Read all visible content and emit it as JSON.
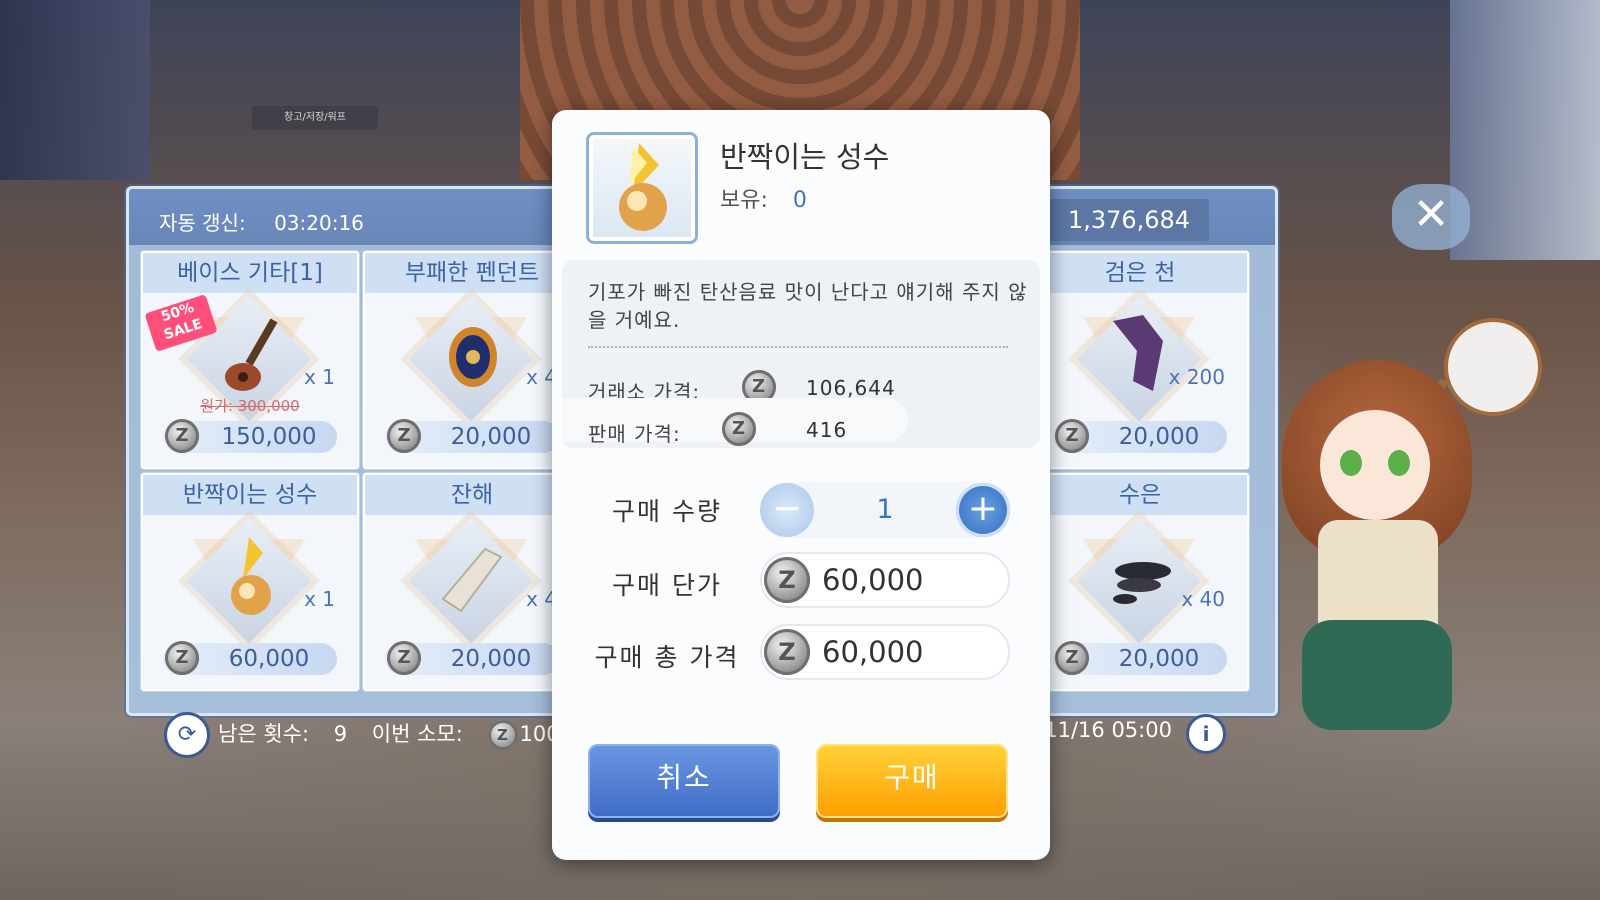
{
  "background": {
    "quest_label": "창고/저장/워프"
  },
  "shop": {
    "auto_refresh_label": "자동 갱신:",
    "auto_refresh_time": "03:20:16",
    "currency_amount": "1,376,684",
    "items": [
      {
        "name": "베이스 기타[1]",
        "qty": "x 1",
        "price": "150,000",
        "sale": "50% SALE",
        "original_price": "원가: 300,000"
      },
      {
        "name": "부패한 펜던트",
        "qty": "x 4",
        "price": "20,000"
      },
      {
        "name": "검은 천",
        "qty": "x 200",
        "price": "20,000"
      },
      {
        "name": "반짝이는 성수",
        "qty": "x 1",
        "price": "60,000"
      },
      {
        "name": "잔해",
        "qty": "x 4",
        "price": "20,000"
      },
      {
        "name": "수은",
        "qty": "x 40",
        "price": "20,000"
      }
    ],
    "remaining_label": "남은 횟수:",
    "remaining_count": "9",
    "consume_label": "이번 소모:",
    "consume_value": "100",
    "period_text": "- 11/16 05:00"
  },
  "modal": {
    "item_name": "반짝이는 성수",
    "owned_label": "보유:",
    "owned_count": "0",
    "description": "기포가 빠진 탄산음료 맛이 난다고 얘기해 주지 않을 거예요.",
    "exchange_price_label": "거래소 가격:",
    "exchange_price": "106,644",
    "sell_price_label": "판매 가격:",
    "sell_price": "416",
    "quantity_label": "구매 수량",
    "quantity": "1",
    "unit_price_label": "구매 단가",
    "unit_price": "60,000",
    "total_price_label": "구매 총 가격",
    "total_price": "60,000",
    "cancel_label": "취소",
    "buy_label": "구매"
  },
  "colors": {
    "accent_blue": "#3b74c4",
    "buy_orange": "#ff9e00",
    "cancel_blue": "#3e6bc4"
  }
}
